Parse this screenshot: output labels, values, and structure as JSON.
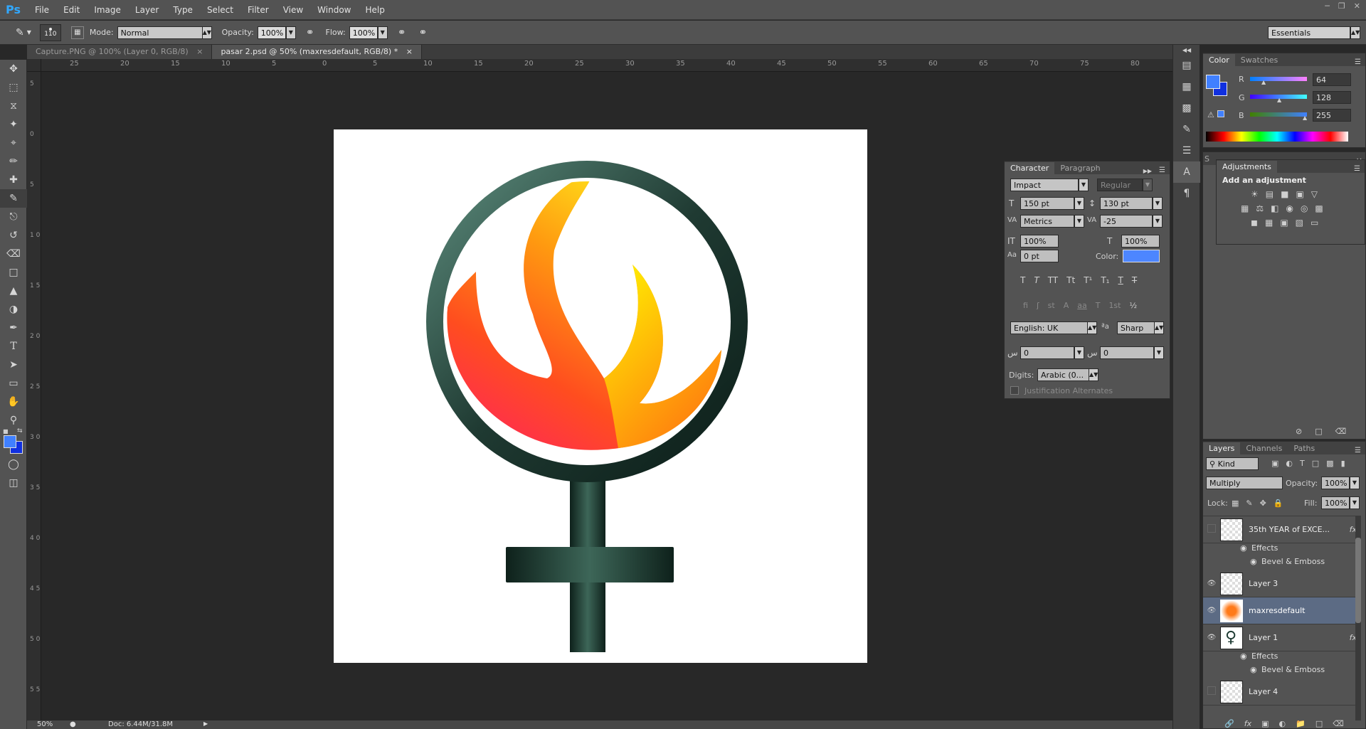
{
  "app": {
    "logo": "Ps"
  },
  "menu": [
    "File",
    "Edit",
    "Image",
    "Layer",
    "Type",
    "Select",
    "Filter",
    "View",
    "Window",
    "Help"
  ],
  "options": {
    "brush_size": "110",
    "mode_label": "Mode:",
    "mode_value": "Normal",
    "opacity_label": "Opacity:",
    "opacity_value": "100%",
    "flow_label": "Flow:",
    "flow_value": "100%",
    "workspace": "Essentials"
  },
  "tabs": [
    {
      "label": "Capture.PNG @ 100% (Layer 0, RGB/8)"
    },
    {
      "label": "pasar 2.psd @ 50% (maxresdefault, RGB/8) *"
    }
  ],
  "ruler_top": [
    "25",
    "20",
    "15",
    "10",
    "5",
    "0",
    "5",
    "10",
    "15",
    "20",
    "25",
    "30",
    "35",
    "40",
    "45",
    "50",
    "55",
    "60",
    "65",
    "70",
    "75",
    "80"
  ],
  "ruler_left": [
    "5",
    "0",
    "5",
    "1 0",
    "1 5",
    "2 0",
    "2 5",
    "3 0",
    "3 5",
    "4 0",
    "4 5",
    "5 0",
    "5 5"
  ],
  "status": {
    "zoom": "50%",
    "doc": "Doc: 6.44M/31.8M"
  },
  "color_panel": {
    "tabs": [
      "Color",
      "Swatches"
    ],
    "r_label": "R",
    "g_label": "G",
    "b_label": "B",
    "r": "64",
    "g": "128",
    "b": "255",
    "fg": "#4080ff",
    "bg": "#1030e0"
  },
  "character": {
    "tabs": [
      "Character",
      "Paragraph"
    ],
    "font": "Impact",
    "style": "Regular",
    "size": "150 pt",
    "leading": "130 pt",
    "kerning": "Metrics",
    "tracking": "-25",
    "vscale": "100%",
    "hscale": "100%",
    "baseline": "0 pt",
    "color_label": "Color:",
    "color": "#4d86ff",
    "language": "English: UK",
    "aa_label": "a",
    "antialias": "Sharp",
    "arabic1": "0",
    "arabic2": "0",
    "digits_label": "Digits:",
    "digits": "Arabic (0...",
    "justification": "Justification Alternates"
  },
  "adjustments": {
    "title": "Adjustments",
    "subtitle": "Add an adjustment"
  },
  "layers_panel": {
    "tabs": [
      "Layers",
      "Channels",
      "Paths"
    ],
    "kind": "Kind",
    "blend": "Multiply",
    "opacity_label": "Opacity:",
    "opacity": "100%",
    "lock_label": "Lock:",
    "fill_label": "Fill:",
    "fill": "100%",
    "layers": [
      {
        "name": "35th  YEAR of EXCE...",
        "fx": "fx"
      },
      {
        "name": "Layer 3"
      },
      {
        "name": "maxresdefault"
      },
      {
        "name": "Layer 1",
        "fx": "fx"
      },
      {
        "name": "Layer 4"
      }
    ],
    "effects": "Effects",
    "bevel": "Bevel & Emboss"
  }
}
